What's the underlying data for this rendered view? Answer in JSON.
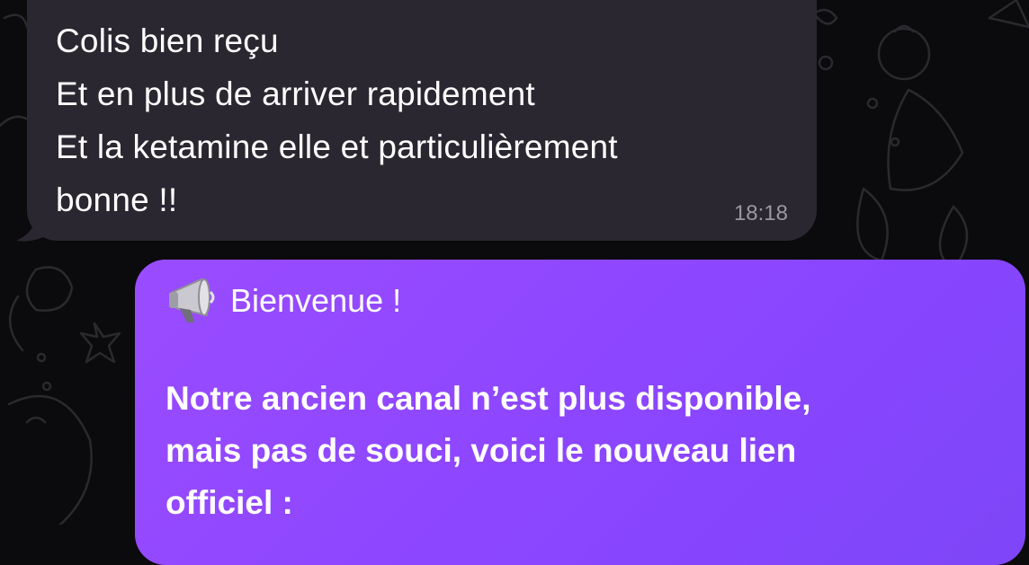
{
  "chat": {
    "incoming": {
      "lines": [
        "Colis bien reçu",
        "Et en plus de arriver rapidement",
        "Et la ketamine elle et particulièrement",
        "bonne !!"
      ],
      "time": "18:18"
    },
    "outgoing": {
      "icon": "megaphone-icon",
      "title": "Bienvenue !",
      "body_lines": [
        "Notre ancien canal n’est plus disponible,",
        "mais pas de souci, voici le nouveau lien",
        "officiel :"
      ]
    }
  },
  "colors": {
    "background": "#0b0b0d",
    "incoming_bubble": "#2a2730",
    "outgoing_bubble": "#9a4cff",
    "timestamp": "#9b97a3"
  }
}
